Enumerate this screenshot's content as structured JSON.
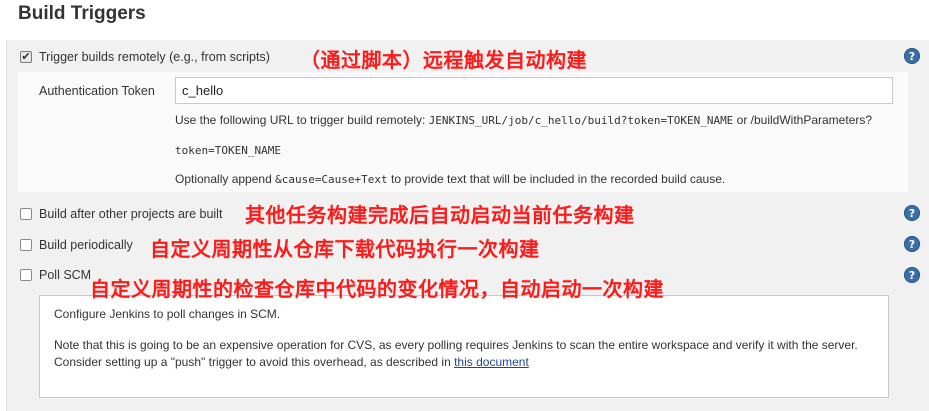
{
  "section": {
    "title": "Build Triggers"
  },
  "triggers": {
    "remote": {
      "label": "Trigger builds remotely",
      "hint": " (e.g., from scripts)",
      "checked": true,
      "auth_label": "Authentication Token",
      "token_value": "c_hello",
      "help1_prefix": "Use the following URL to trigger build remotely: ",
      "help1_code": "JENKINS_URL/job/c_hello/build?token=TOKEN_NAME",
      "help1_suffix": " or /buildWithParameters?",
      "help2_code": "token=TOKEN_NAME",
      "help3_prefix": "Optionally append ",
      "help3_code": "&cause=Cause+Text",
      "help3_suffix": " to provide text that will be included in the recorded build cause."
    },
    "after_other": {
      "label": "Build after other projects are built",
      "checked": false
    },
    "periodically": {
      "label": "Build periodically",
      "checked": false
    },
    "poll_scm": {
      "label": "Poll SCM",
      "checked": false,
      "para1": "Configure Jenkins to poll changes in SCM.",
      "para2": "Note that this is going to be an expensive operation for CVS, as every polling requires Jenkins to scan the entire workspace and verify it with the server. Consider setting up a \"push\" trigger to avoid this overhead, as described in ",
      "link": "this document"
    }
  },
  "help_icon_glyph": "?",
  "annotations": {
    "remote": "（通过脚本）远程触发自动构建",
    "after_other": "其他任务构建完成后自动启动当前任务构建",
    "periodically": "自定义周期性从仓库下载代码执行一次构建",
    "poll_scm": "自定义周期性的检查仓库中代码的变化情况，自动启动一次构建"
  },
  "colors": {
    "annotation": "#ff1a1a",
    "help_icon": "#3a6ea5",
    "panel": "#f1f1f1"
  }
}
